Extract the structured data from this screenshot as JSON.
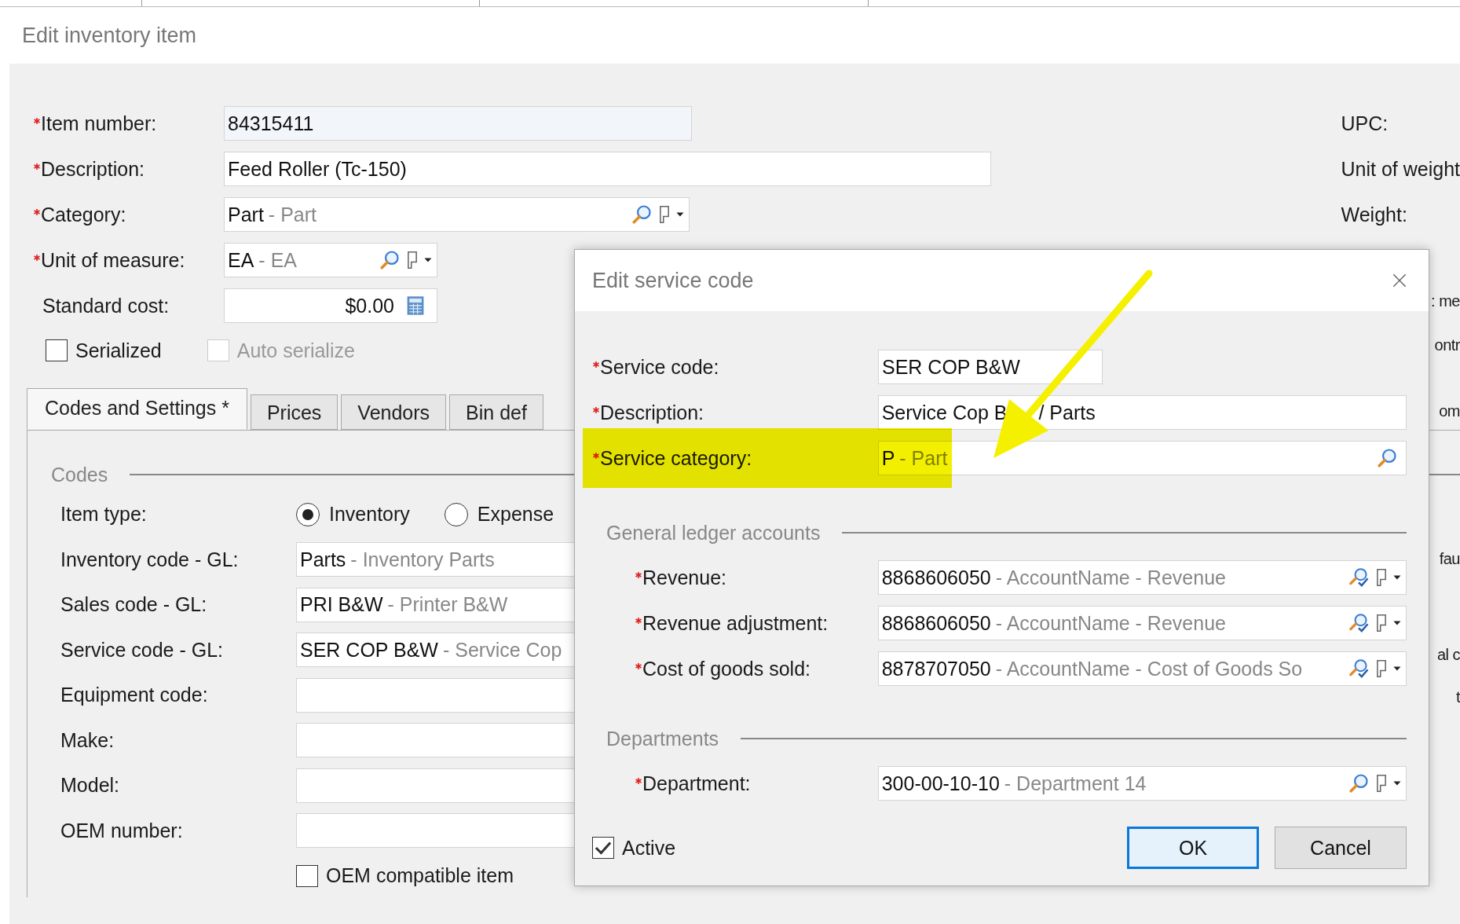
{
  "window": {
    "title": "Edit inventory item"
  },
  "fields": [
    {
      "label": "Item number:",
      "required": true,
      "kind": "text",
      "value": "84315411",
      "readonly": true
    },
    {
      "label": "Description:",
      "required": true,
      "kind": "text",
      "value": "Feed Roller (Tc-150)",
      "readonly": false
    },
    {
      "label": "Category:",
      "required": true,
      "kind": "lookup_menu",
      "value": "Part",
      "description": "- Part",
      "readonly": false
    },
    {
      "label": "Unit of measure:",
      "required": true,
      "kind": "lookup_menu",
      "value": "EA",
      "description": "- EA",
      "readonly": false
    },
    {
      "label": "Standard cost:",
      "required": false,
      "kind": "amount",
      "value": "$0.00",
      "readonly": false
    }
  ],
  "checkboxes": [
    {
      "label": "Serialized",
      "checked": false,
      "disabled": false
    },
    {
      "label": "Auto serialize",
      "checked": false,
      "disabled": true
    }
  ],
  "right_labels": [
    "UPC:",
    "Unit of weight",
    "Weight:"
  ],
  "right_fragments": [
    ": me",
    "ontr",
    "om",
    "fau",
    "al c",
    "t"
  ],
  "tabs": [
    {
      "label": "Codes and Settings *",
      "selected": true
    },
    {
      "label": "Prices",
      "selected": false
    },
    {
      "label": "Vendors",
      "selected": false
    },
    {
      "label": "Bin def",
      "selected": false
    }
  ],
  "codes": {
    "legend": "Codes",
    "item_type": {
      "label": "Item type:",
      "options": [
        {
          "label": "Inventory",
          "selected": true
        },
        {
          "label": "Expense",
          "selected": false
        }
      ]
    },
    "fields": [
      {
        "label": "Inventory code - GL:",
        "value": "Parts",
        "description": "- Inventory Parts"
      },
      {
        "label": "Sales code - GL:",
        "value": "PRI B&W",
        "description": "- Printer B&W"
      },
      {
        "label": "Service code - GL:",
        "value": "SER COP B&W",
        "description": "- Service Cop"
      },
      {
        "label": "Equipment code:"
      },
      {
        "label": "Make:"
      },
      {
        "label": "Model:"
      },
      {
        "label": "OEM number:"
      }
    ],
    "oem_compatible": {
      "label": "OEM compatible item",
      "checked": false
    }
  },
  "dialog": {
    "title": "Edit service code",
    "fields": [
      {
        "label": "Service code:",
        "required": true,
        "kind": "text",
        "value": "SER COP B&W",
        "highlighted": false
      },
      {
        "label": "Description:",
        "required": true,
        "kind": "text",
        "value": "Service Cop B",
        "value_after": "/ Parts",
        "highlighted": false
      },
      {
        "label": "Service category:",
        "required": true,
        "kind": "lookup",
        "value": "P",
        "description": "- Part",
        "highlighted": true
      }
    ],
    "sections": [
      {
        "legend": "General ledger accounts",
        "fields": [
          {
            "label": "Revenue:",
            "required": true,
            "kind": "account",
            "value": "8868606050",
            "description": "- AccountName - Revenue"
          },
          {
            "label": "Revenue adjustment:",
            "required": true,
            "kind": "account",
            "value": "8868606050",
            "description": "- AccountName - Revenue"
          },
          {
            "label": "Cost of goods sold:",
            "required": true,
            "kind": "account",
            "value": "8878707050",
            "description": "- AccountName - Cost of Goods So"
          }
        ]
      },
      {
        "legend": "Departments",
        "fields": [
          {
            "label": "Department:",
            "required": true,
            "kind": "lookup_menu",
            "value": "300-00-10-10",
            "description": "- Department 14"
          }
        ]
      }
    ],
    "active": {
      "label": "Active",
      "checked": true
    },
    "buttons": [
      {
        "label": "OK",
        "default": true
      },
      {
        "label": "Cancel",
        "default": false
      }
    ]
  },
  "arrow_annotation": true
}
